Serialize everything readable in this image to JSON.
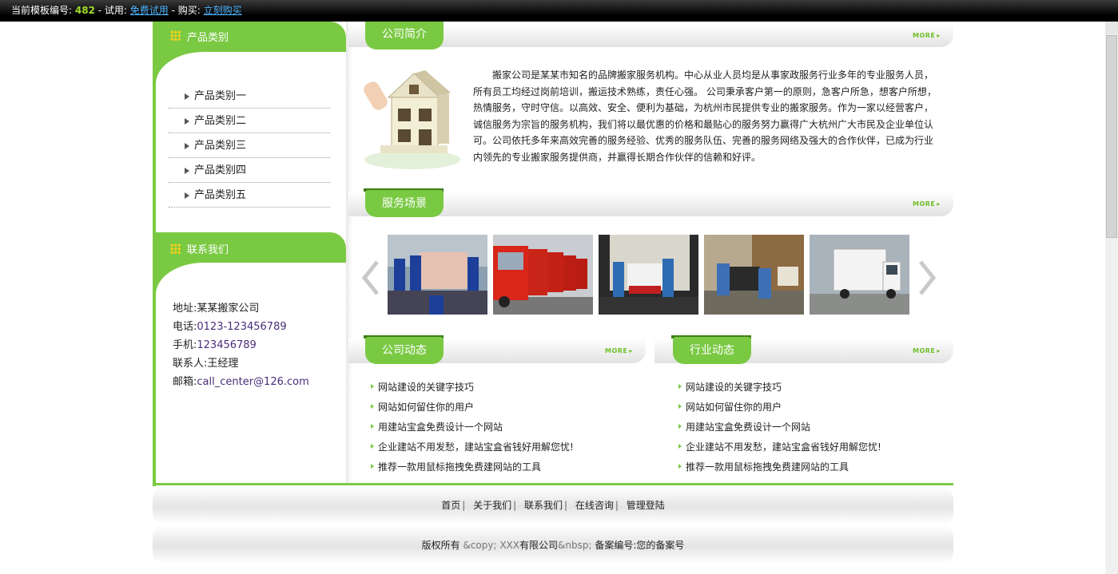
{
  "topbar": {
    "label_prefix": "当前模板编号:",
    "template_number": "482",
    "trial_prefix": "- 试用:",
    "trial_link": "免费试用",
    "buy_prefix": "- 购买:",
    "buy_link": "立刻购买"
  },
  "sidebar": {
    "categories_title": "产品类别",
    "categories": [
      "产品类别一",
      "产品类别二",
      "产品类别三",
      "产品类别四",
      "产品类别五"
    ],
    "contact_title": "联系我们",
    "contact": [
      {
        "label": "地址:",
        "value": "某某搬家公司"
      },
      {
        "label": "电话:",
        "value": "0123-123456789"
      },
      {
        "label": "手机:",
        "value": "123456789"
      },
      {
        "label": "联系人:",
        "value": "王经理"
      },
      {
        "label": "邮箱:",
        "value": "call_center@126.com"
      }
    ]
  },
  "about": {
    "title": "公司简介",
    "more": "MORE",
    "text": "搬家公司是某某市知名的品牌搬家服务机构。中心从业人员均是从事家政服务行业多年的专业服务人员，所有员工均经过岗前培训，搬运技术熟练，责任心强。 公司秉承客户第一的原则，急客户所急，想客户所想，热情服务，守时守信。以高效、安全、便利为基础，为杭州市民提供专业的搬家服务。作为一家以经营客户，诚信服务为宗旨的服务机构，我们将以最优惠的价格和最贴心的服务努力赢得广大杭州广大市民及企业单位认可。公司依托多年来高效完善的服务经验、优秀的服务队伍、完善的服务网络及强大的合作伙伴，已成为行业内领先的专业搬家服务提供商，并赢得长期合作伙伴的信赖和好评。"
  },
  "scenes": {
    "title": "服务场景",
    "more": "MORE"
  },
  "company_news": {
    "title": "公司动态",
    "more": "MORE",
    "items": [
      "网站建设的关键字技巧",
      "网站如何留住你的用户",
      "用建站宝盒免费设计一个网站",
      "企业建站不用发愁，建站宝盒省钱好用解您忧!",
      "推荐一款用鼠标拖拽免费建网站的工具"
    ]
  },
  "industry_news": {
    "title": "行业动态",
    "more": "MORE",
    "items": [
      "网站建设的关键字技巧",
      "网站如何留住你的用户",
      "用建站宝盒免费设计一个网站",
      "企业建站不用发愁，建站宝盒省钱好用解您忧!",
      "推荐一款用鼠标拖拽免费建网站的工具"
    ]
  },
  "footer": {
    "nav": [
      "首页",
      "关于我们",
      "联系我们",
      "在线咨询",
      "管理登陆"
    ],
    "separator": "|",
    "copy_a": "版权所有 ",
    "copy_b": "&copy; XXX",
    "copy_c": "有限公司",
    "copy_d": "&nbsp; ",
    "copy_e": "备案编号:您的备案号"
  },
  "colors": {
    "accent": "#7ac943",
    "link": "#4fb5ff",
    "number": "#9fdc2a"
  }
}
